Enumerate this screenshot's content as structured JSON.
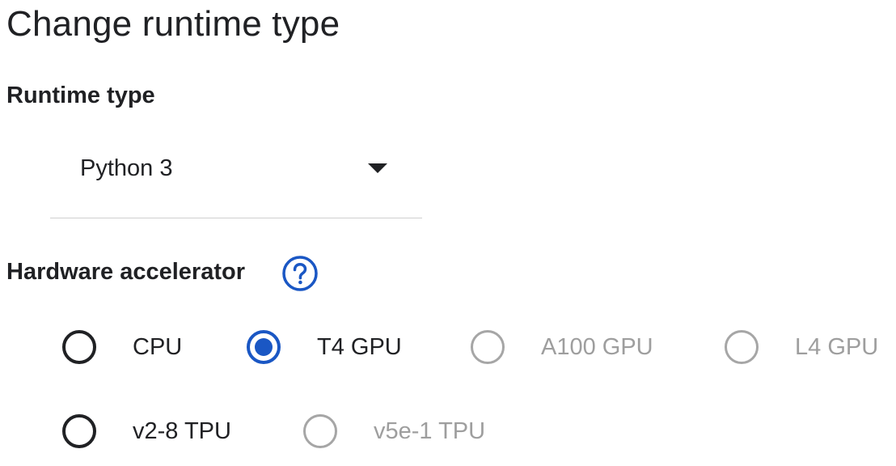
{
  "dialog": {
    "title": "Change runtime type"
  },
  "runtime": {
    "label": "Runtime type",
    "selected": "Python 3",
    "arrow_icon": "dropdown-arrow-icon"
  },
  "hardware": {
    "label": "Hardware accelerator",
    "help_icon": "help-circle-icon",
    "options": [
      {
        "label": "CPU",
        "checked": false,
        "disabled": false
      },
      {
        "label": "T4 GPU",
        "checked": true,
        "disabled": false
      },
      {
        "label": "A100 GPU",
        "checked": false,
        "disabled": true
      },
      {
        "label": "L4 GPU",
        "checked": false,
        "disabled": true
      },
      {
        "label": "v2-8 TPU",
        "checked": false,
        "disabled": false
      },
      {
        "label": "v5e-1 TPU",
        "checked": false,
        "disabled": true
      }
    ]
  },
  "colors": {
    "accent": "#1a57c4",
    "text": "#202124",
    "disabled": "#9e9e9e",
    "divider": "#cfcfcf"
  }
}
